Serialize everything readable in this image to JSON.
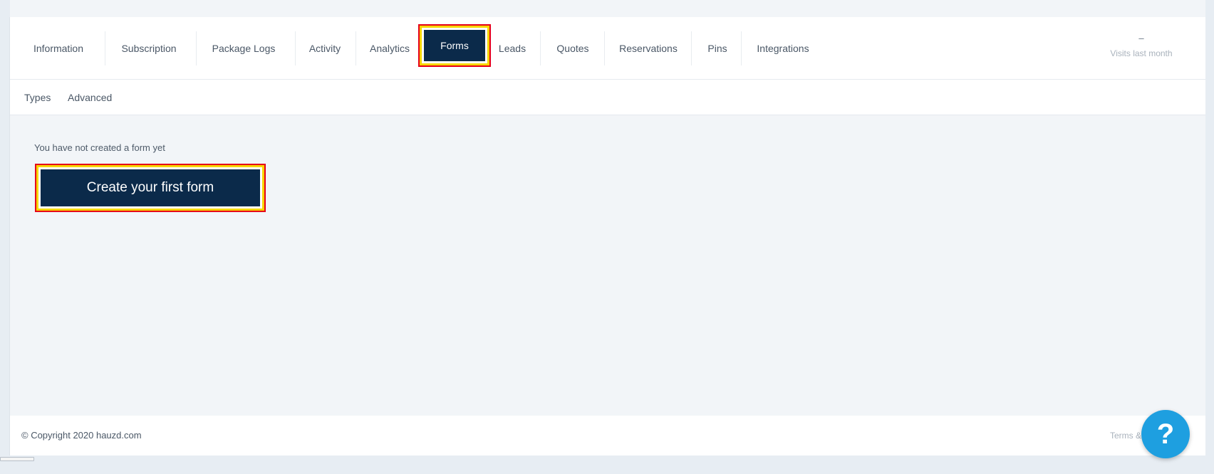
{
  "tabs": [
    {
      "label": "Information"
    },
    {
      "label": "Subscription"
    },
    {
      "label": "Package Logs"
    },
    {
      "label": "Activity"
    },
    {
      "label": "Analytics"
    },
    {
      "label": "Forms"
    },
    {
      "label": "Leads"
    },
    {
      "label": "Quotes"
    },
    {
      "label": "Reservations"
    },
    {
      "label": "Pins"
    },
    {
      "label": "Integrations"
    }
  ],
  "active_tab": "Forms",
  "visits": {
    "value": "–",
    "label": "Visits last month"
  },
  "subnav": [
    {
      "label": "Types"
    },
    {
      "label": "Advanced"
    }
  ],
  "empty_state": {
    "message": "You have not created a form yet",
    "cta_label": "Create your first form"
  },
  "footer": {
    "copyright": "© Copyright 2020 hauzd.com",
    "terms": "Terms & Conditions"
  },
  "help": {
    "glyph": "?"
  },
  "colors": {
    "primary": "#0b2a4a",
    "help": "#1e9fe0",
    "highlight_yellow": "#f7d600",
    "highlight_red": "#e6001a"
  }
}
